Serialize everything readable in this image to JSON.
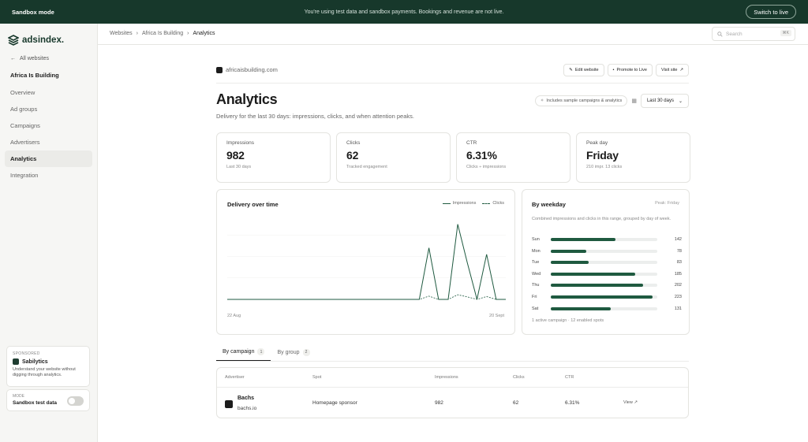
{
  "topbar": {
    "mode": "Sandbox mode",
    "message": "You're using test data and sandbox payments. Bookings and revenue are not live.",
    "switch_label": "Switch to live"
  },
  "sidebar": {
    "logo": "adsindex.",
    "back_label": "All websites",
    "site_name": "Africa Is Building",
    "items": [
      {
        "label": "Overview"
      },
      {
        "label": "Ad groups"
      },
      {
        "label": "Campaigns"
      },
      {
        "label": "Advertisers"
      },
      {
        "label": "Analytics"
      },
      {
        "label": "Integration"
      }
    ],
    "sponsored": {
      "tag": "SPONSORED",
      "brand": "Sabilytics",
      "desc": "Understand your website without digging through analytics."
    },
    "mode": {
      "tag": "MODE",
      "value": "Sandbox test data"
    }
  },
  "header": {
    "crumbs": [
      "Websites",
      "Africa Is Building",
      "Analytics"
    ],
    "search_placeholder": "Search",
    "search_kbd": "⌘K"
  },
  "page": {
    "domain": "africaisbuilding.com",
    "actions": {
      "edit": "Edit website",
      "promote": "Promote to Live",
      "visit": "Visit site"
    },
    "title": "Analytics",
    "subtitle": "Delivery for the last 30 days: impressions, clicks, and when attention peaks.",
    "sample_pill": "Includes sample campaigns & analytics",
    "date_range": "Last 30 days"
  },
  "stats": [
    {
      "label": "Impressions",
      "value": "982",
      "sub": "Last 30 days"
    },
    {
      "label": "Clicks",
      "value": "62",
      "sub": "Tracked engagement"
    },
    {
      "label": "CTR",
      "value": "6.31%",
      "sub": "Clicks ÷ impressions"
    },
    {
      "label": "Peak day",
      "value": "Friday",
      "sub": "210 impr. 13 clicks"
    }
  ],
  "delivery": {
    "title": "Delivery over time",
    "legend_impressions": "Impressions",
    "legend_clicks": "Clicks",
    "x_start": "22 Aug",
    "x_end": "20 Sept"
  },
  "chart_data": {
    "type": "line",
    "x": [
      "22 Aug",
      "23 Aug",
      "24 Aug",
      "25 Aug",
      "26 Aug",
      "27 Aug",
      "28 Aug",
      "29 Aug",
      "30 Aug",
      "31 Aug",
      "1 Sept",
      "2 Sept",
      "3 Sept",
      "4 Sept",
      "5 Sept",
      "6 Sept",
      "7 Sept",
      "8 Sept",
      "9 Sept",
      "10 Sept",
      "11 Sept",
      "12 Sept",
      "13 Sept",
      "14 Sept",
      "15 Sept",
      "16 Sept",
      "17 Sept",
      "18 Sept",
      "19 Sept",
      "20 Sept"
    ],
    "series": [
      {
        "name": "Impressions",
        "values": [
          0,
          0,
          0,
          0,
          0,
          0,
          0,
          0,
          0,
          0,
          0,
          0,
          0,
          0,
          0,
          0,
          0,
          0,
          0,
          0,
          0,
          144,
          0,
          0,
          210,
          102,
          0,
          126,
          0,
          0
        ]
      },
      {
        "name": "Clicks",
        "values": [
          0,
          0,
          0,
          0,
          0,
          0,
          0,
          0,
          0,
          0,
          0,
          0,
          0,
          0,
          0,
          0,
          0,
          0,
          0,
          0,
          0,
          9,
          0,
          0,
          13,
          7,
          0,
          8,
          0,
          0
        ]
      }
    ],
    "ylim": [
      0,
      240
    ]
  },
  "weekday": {
    "title": "By weekday",
    "peak": "Peak: Friday",
    "desc": "Combined impressions and clicks in this range, grouped by day of week.",
    "footer": "1 active campaign · 12 enabled spots",
    "max": 233,
    "days": [
      {
        "day": "Sun",
        "value": 142
      },
      {
        "day": "Mon",
        "value": 78
      },
      {
        "day": "Tue",
        "value": 83
      },
      {
        "day": "Wed",
        "value": 185
      },
      {
        "day": "Thu",
        "value": 202
      },
      {
        "day": "Fri",
        "value": 223
      },
      {
        "day": "Sat",
        "value": 131
      }
    ]
  },
  "tabs": [
    {
      "label": "By campaign",
      "count": "1"
    },
    {
      "label": "By group",
      "count": "2"
    }
  ],
  "table": {
    "headers": [
      "Advertiser",
      "Spot",
      "Impressions",
      "Clicks",
      "CTR"
    ],
    "rows": [
      {
        "name": "Bachs",
        "url": "bachs.io",
        "spot": "Homepage sponsor",
        "impressions": "982",
        "clicks": "62",
        "ctr": "6.31%",
        "action": "View"
      }
    ]
  },
  "colors": {
    "accent": "#17382b",
    "chart": "#1f5a40"
  }
}
